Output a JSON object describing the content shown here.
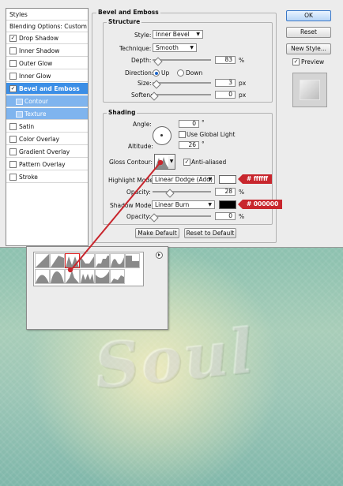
{
  "styles_panel": {
    "title": "Styles",
    "blending_options": "Blending Options: Custom",
    "items": [
      {
        "label": "Drop Shadow",
        "checked": true
      },
      {
        "label": "Inner Shadow",
        "checked": false
      },
      {
        "label": "Outer Glow",
        "checked": false
      },
      {
        "label": "Inner Glow",
        "checked": false
      },
      {
        "label": "Bevel and Emboss",
        "checked": true,
        "selected": true
      },
      {
        "label": "Contour",
        "sub": true
      },
      {
        "label": "Texture",
        "sub": true
      },
      {
        "label": "Satin",
        "checked": false
      },
      {
        "label": "Color Overlay",
        "checked": false
      },
      {
        "label": "Gradient Overlay",
        "checked": false
      },
      {
        "label": "Pattern Overlay",
        "checked": false
      },
      {
        "label": "Stroke",
        "checked": false
      }
    ]
  },
  "bevel": {
    "title": "Bevel and Emboss",
    "structure": {
      "title": "Structure",
      "style_label": "Style:",
      "style_value": "Inner Bevel",
      "technique_label": "Technique:",
      "technique_value": "Smooth",
      "depth_label": "Depth:",
      "depth_value": "83",
      "depth_unit": "%",
      "direction_label": "Direction:",
      "direction_up": "Up",
      "direction_down": "Down",
      "size_label": "Size:",
      "size_value": "3",
      "size_unit": "px",
      "soften_label": "Soften:",
      "soften_value": "0",
      "soften_unit": "px"
    },
    "shading": {
      "title": "Shading",
      "angle_label": "Angle:",
      "angle_value": "0",
      "angle_unit": "°",
      "use_global_light": "Use Global Light",
      "altitude_label": "Altitude:",
      "altitude_value": "26",
      "altitude_unit": "°",
      "gloss_contour_label": "Gloss Contour:",
      "anti_aliased": "Anti-aliased",
      "highlight_mode_label": "Highlight Mode:",
      "highlight_mode_value": "Linear Dodge (Add)",
      "highlight_opacity_label": "Opacity:",
      "highlight_opacity_value": "28",
      "highlight_opacity_unit": "%",
      "highlight_color": "#ffffff",
      "highlight_color_tag": "# ffffff",
      "shadow_mode_label": "Shadow Mode:",
      "shadow_mode_value": "Linear Burn",
      "shadow_opacity_label": "Opacity:",
      "shadow_opacity_value": "0",
      "shadow_opacity_unit": "%",
      "shadow_color": "#000000",
      "shadow_color_tag": "# 000000"
    },
    "make_default": "Make Default",
    "reset_default": "Reset to Default"
  },
  "buttons": {
    "ok": "OK",
    "reset": "Reset",
    "new_style": "New Style...",
    "preview": "Preview"
  },
  "colors": {
    "accent": "#3b8ee6",
    "annotation": "#c8262d"
  }
}
